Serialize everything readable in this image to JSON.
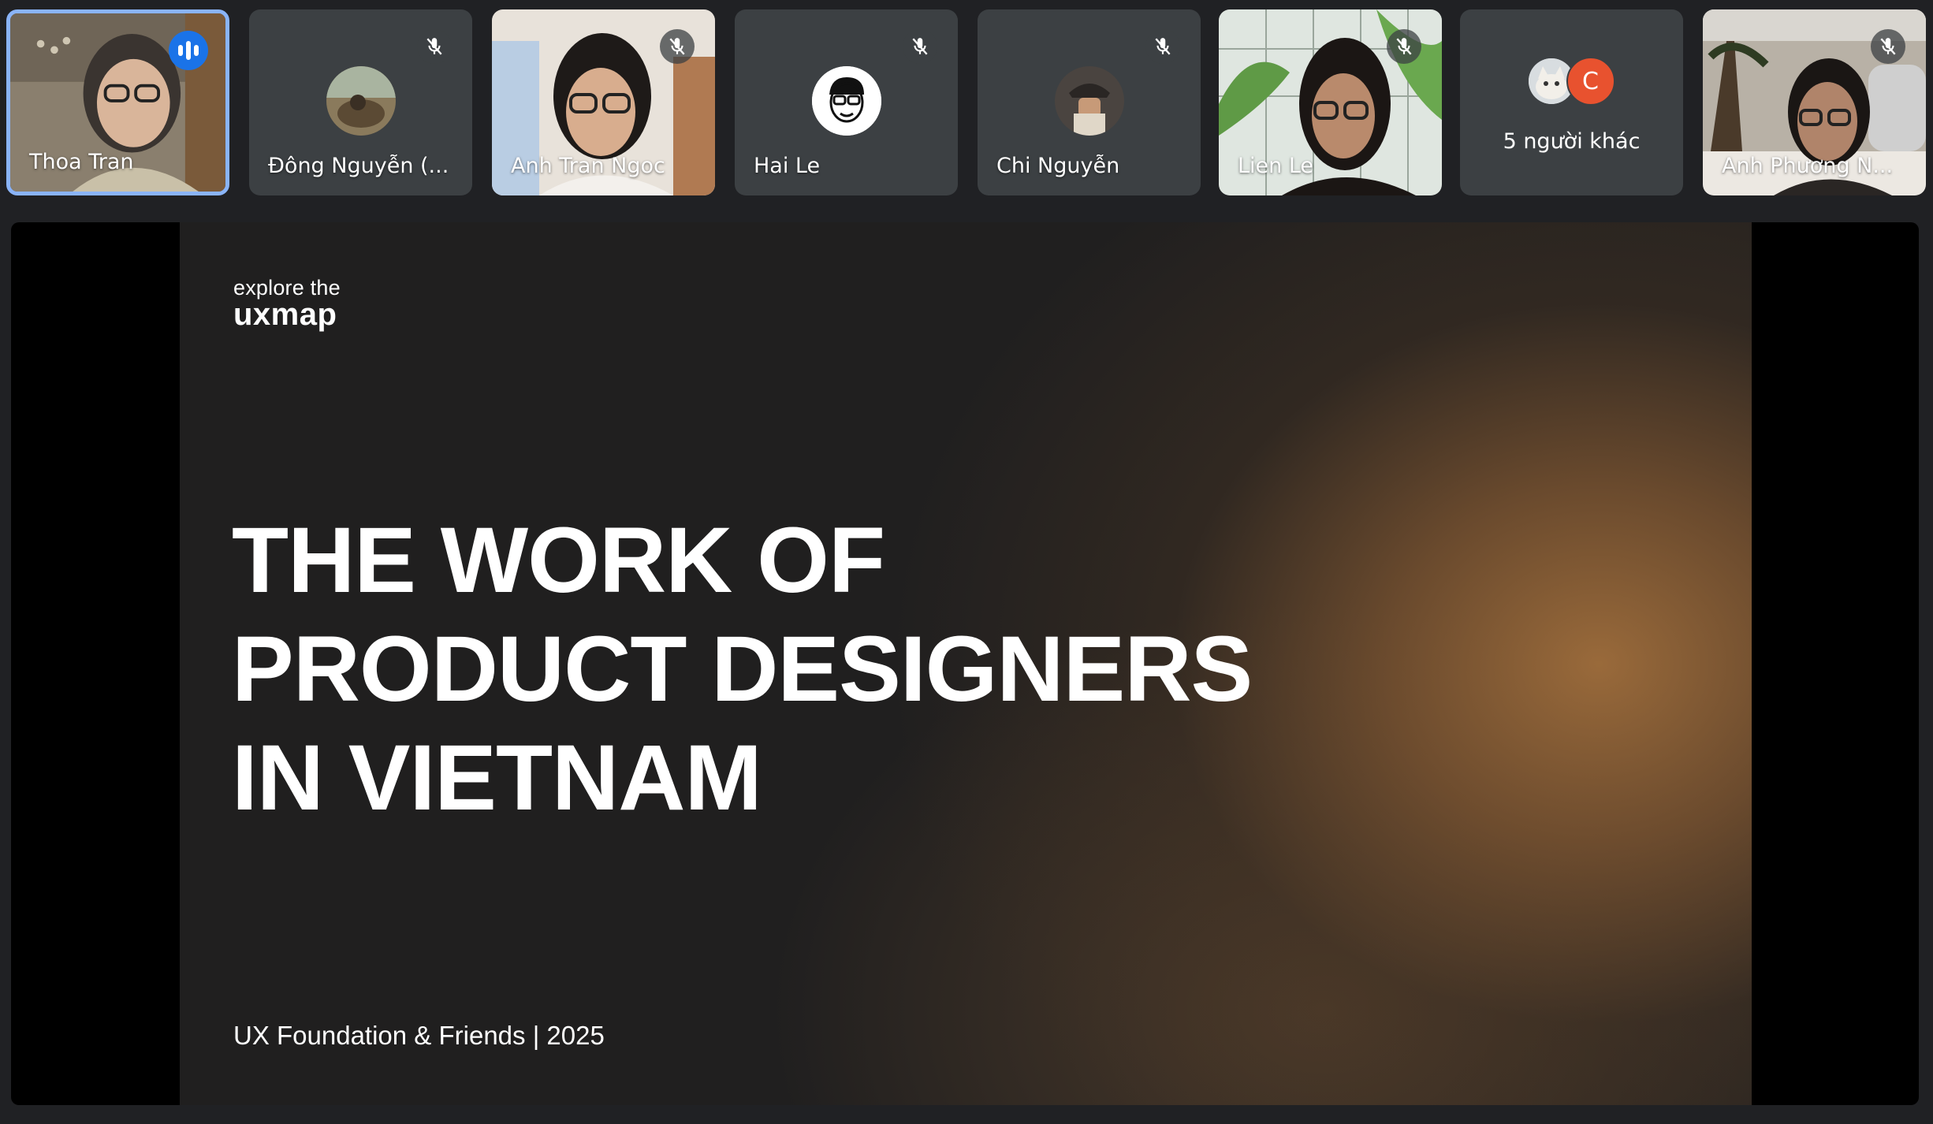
{
  "participants": [
    {
      "name": "Thoa Tran",
      "state": "speaking"
    },
    {
      "name": "Đông Nguyễn (...",
      "state": "muted"
    },
    {
      "name": "Anh Tran Ngoc",
      "state": "muted"
    },
    {
      "name": "Hai Le",
      "state": "muted"
    },
    {
      "name": "Chi Nguyễn",
      "state": "muted"
    },
    {
      "name": "Lien Le",
      "state": "muted"
    },
    {
      "name": "Anh Phương N...",
      "state": "muted"
    }
  ],
  "others": {
    "label": "5 người khác",
    "avatar_letter": "C"
  },
  "slide": {
    "logo_line1": "explore the",
    "logo_line2": "uxmap",
    "title_lines": [
      "THE WORK OF",
      "PRODUCT DESIGNERS",
      "IN VIETNAM"
    ],
    "footer": "UX Foundation & Friends | 2025"
  },
  "colors": {
    "active_border": "#8ab4f8",
    "speaking_badge": "#1a73e8",
    "tile_bg": "#3c4043",
    "other_avatar": "#e8522f"
  },
  "icons": {
    "mute": "mic-off-icon",
    "speaking": "audio-level-icon"
  }
}
